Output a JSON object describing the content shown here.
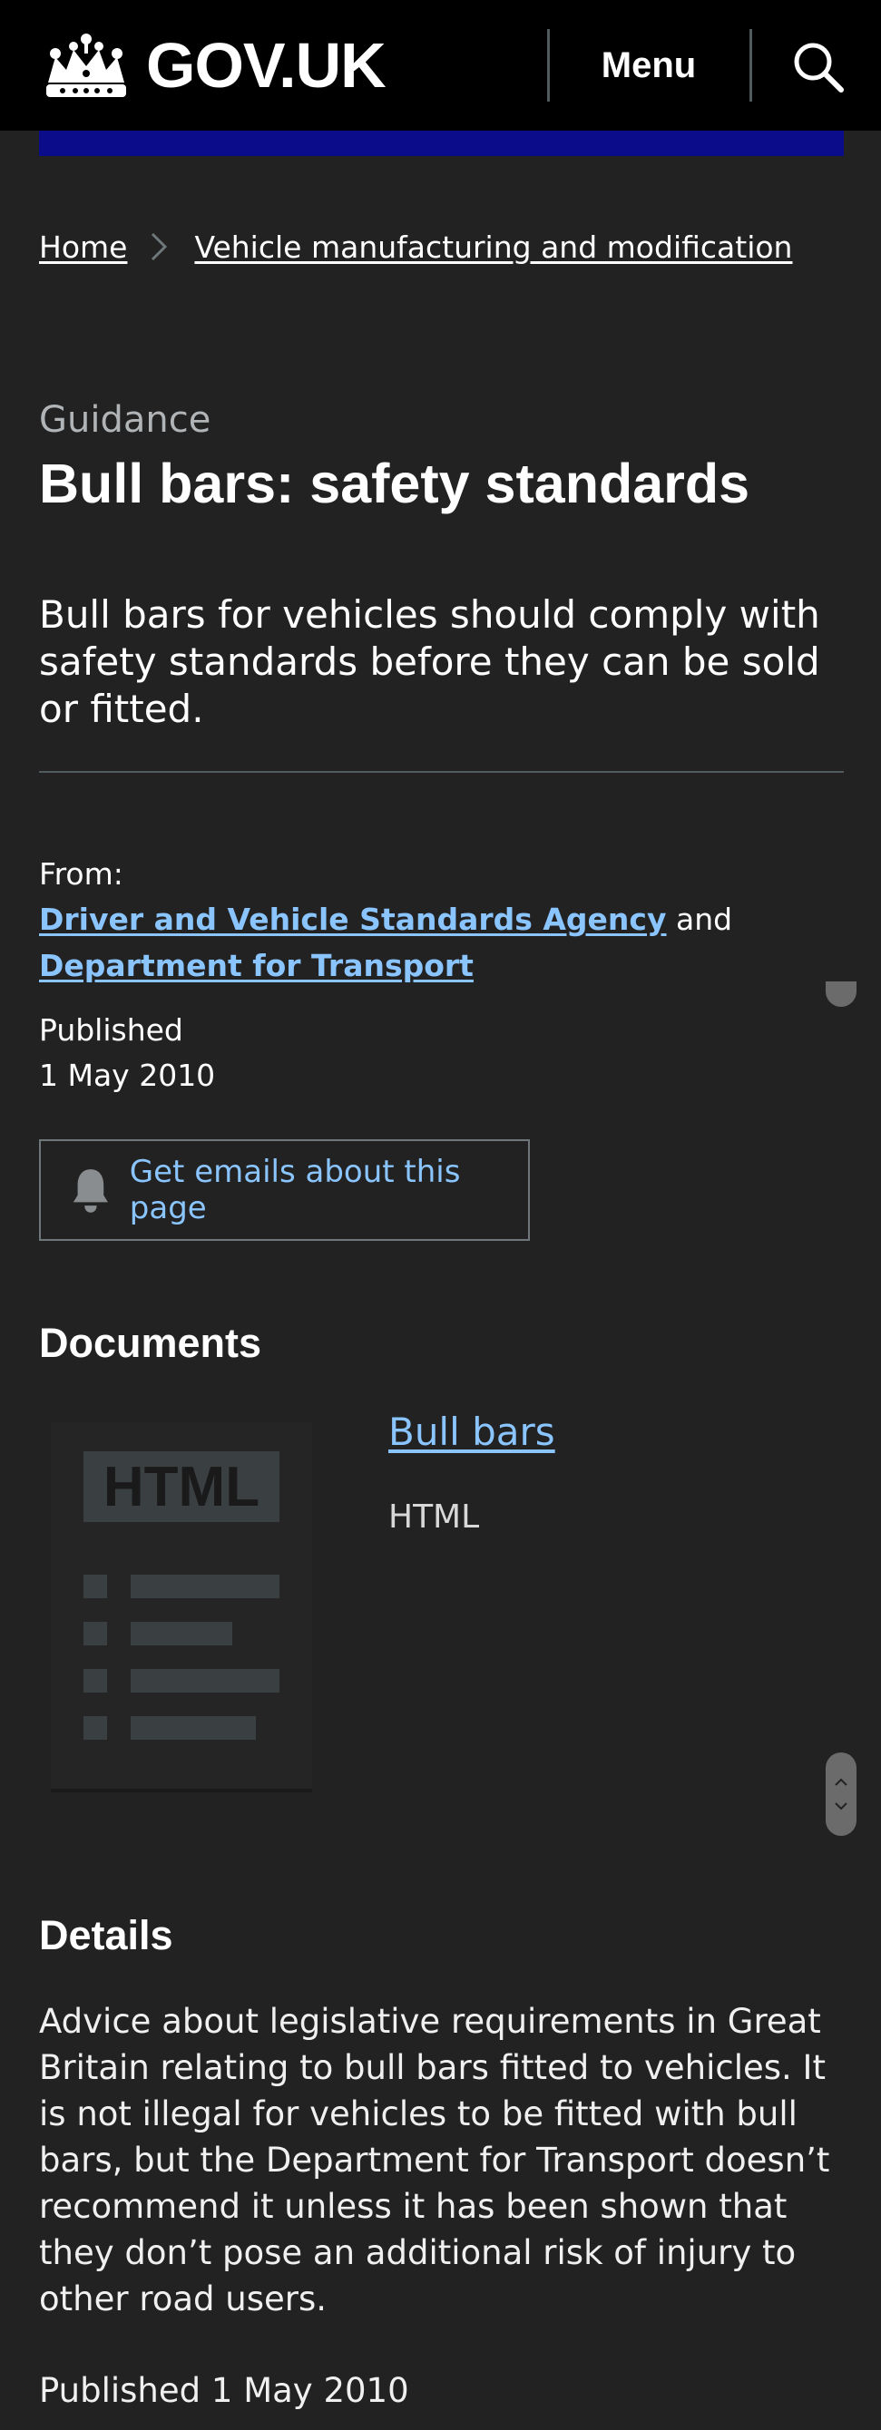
{
  "header": {
    "logo_text": "GOV.UK",
    "menu_label": "Menu"
  },
  "breadcrumb": {
    "items": [
      "Home",
      "Vehicle manufacturing and modification"
    ]
  },
  "page": {
    "caption": "Guidance",
    "title": "Bull bars: safety standards",
    "lead": "Bull bars for vehicles should comply with safety standards before they can be sold or fitted."
  },
  "meta": {
    "from_label": "From:",
    "orgs": [
      "Driver and Vehicle Standards Agency",
      "Department for Transport"
    ],
    "and_word": "and",
    "published_label": "Published",
    "published_date": "1 May 2010"
  },
  "email_button": {
    "label": "Get emails about this page"
  },
  "documents": {
    "heading": "Documents",
    "thumb_label": "HTML",
    "items": [
      {
        "title": "Bull bars",
        "type": "HTML"
      }
    ]
  },
  "details": {
    "heading": "Details",
    "body": "Advice about legislative requirements in Great Britain relating to bull bars fitted to vehicles. It is not illegal for vehicles to be fitted with bull bars, but the Department for Transport doesn’t recommend it unless it has been shown that they don’t pose an additional risk of injury to other road users.",
    "published": "Published 1 May 2010"
  },
  "colors": {
    "link": "#8bc5ff",
    "header_bg": "#000000",
    "page_bg": "#222222",
    "brand_bar": "#0b0c8a"
  }
}
